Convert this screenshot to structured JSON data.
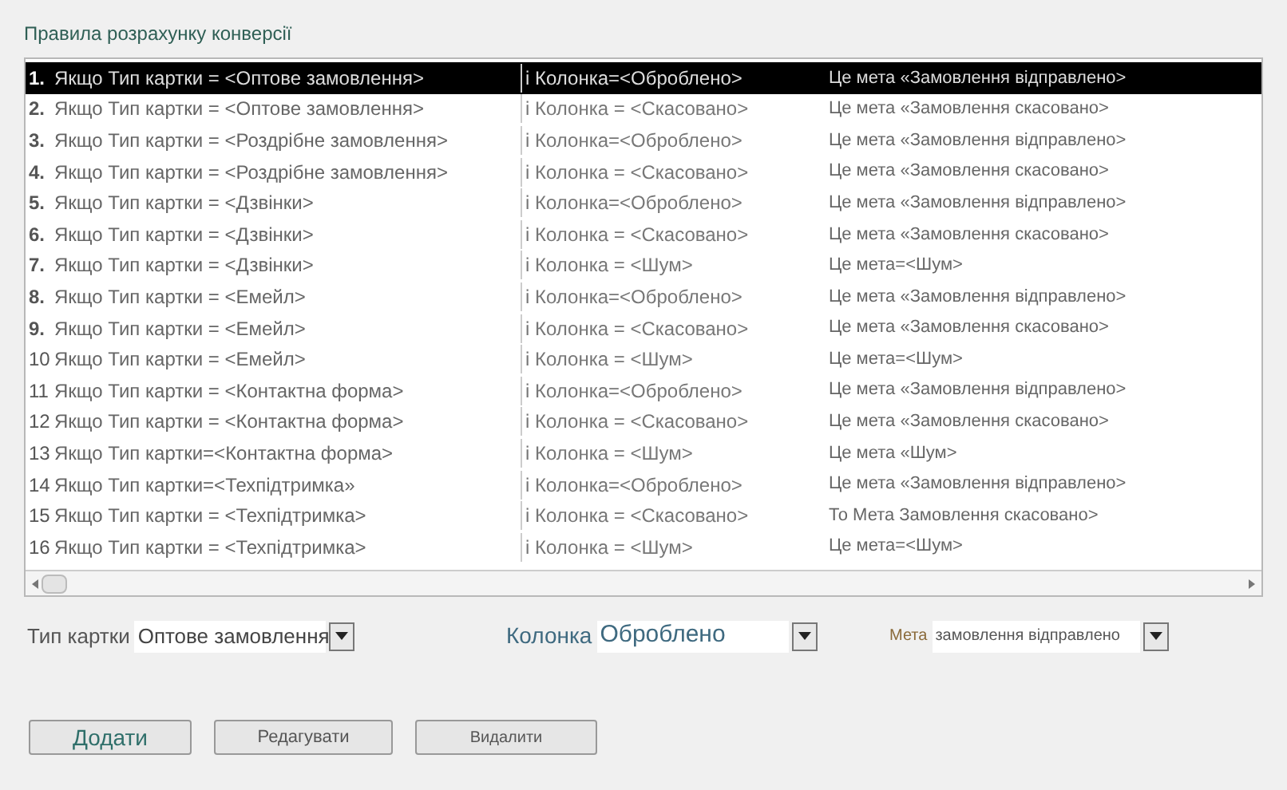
{
  "title": "Правила розрахунку конверсії",
  "rules": [
    {
      "number": "1.",
      "condition": "Якщо Тип картки = <Оптове замовлення>",
      "column": "і Колонка=<Оброблено>",
      "goal": "Це мета «Замовлення відправлено>",
      "selected": true
    },
    {
      "number": "2.",
      "condition": "Якщо Тип картки = <Оптове замовлення>",
      "column": "і Колонка = <Скасовано>",
      "goal": "Це мета «Замовлення скасовано>",
      "selected": false
    },
    {
      "number": "3.",
      "condition": "Якщо Тип картки = <Роздрібне замовлення>",
      "column": "і Колонка=<Оброблено>",
      "goal": "Це мета «Замовлення відправлено>",
      "selected": false
    },
    {
      "number": "4.",
      "condition": "Якщо Тип картки = <Роздрібне замовлення>",
      "column": "і Колонка = <Скасовано>",
      "goal": "Це мета «Замовлення скасовано>",
      "selected": false
    },
    {
      "number": "5.",
      "condition": "Якщо Тип картки = <Дзвінки>",
      "column": "і Колонка=<Оброблено>",
      "goal": "Це мета «Замовлення відправлено>",
      "selected": false
    },
    {
      "number": "6.",
      "condition": "Якщо Тип картки = <Дзвінки>",
      "column": "і Колонка = <Скасовано>",
      "goal": "Це мета «Замовлення скасовано>",
      "selected": false
    },
    {
      "number": "7.",
      "condition": "Якщо Тип картки = <Дзвінки>",
      "column": "і Колонка = <Шум>",
      "goal": "Це мета=<Шум>",
      "selected": false
    },
    {
      "number": "8.",
      "condition": "Якщо Тип картки = <Емейл>",
      "column": "і Колонка=<Оброблено>",
      "goal": "Це мета «Замовлення відправлено>",
      "selected": false
    },
    {
      "number": "9.",
      "condition": "Якщо Тип картки = <Емейл>",
      "column": "і Колонка = <Скасовано>",
      "goal": "Це мета «Замовлення скасовано>",
      "selected": false
    },
    {
      "number": "10",
      "condition": "Якщо Тип картки = <Емейл>",
      "column": "і Колонка = <Шум>",
      "goal": "Це мета=<Шум>",
      "selected": false
    },
    {
      "number": "11",
      "condition": "Якщо Тип картки = <Контактна форма>",
      "column": "і Колонка=<Оброблено>",
      "goal": "Це мета «Замовлення відправлено>",
      "selected": false
    },
    {
      "number": "12",
      "condition": "Якщо Тип картки = <Контактна форма>",
      "column": "і Колонка = <Скасовано>",
      "goal": "Це мета «Замовлення скасовано>",
      "selected": false
    },
    {
      "number": "13",
      "condition": "Якщо Тип картки=<Контактна форма>",
      "column": "і Колонка = <Шум>",
      "goal": "Це мета «Шум>",
      "selected": false
    },
    {
      "number": "14",
      "condition": "Якщо Тип картки=<Техпідтримка»",
      "column": "і Колонка=<Оброблено>",
      "goal": "Це мета «Замовлення відправлено>",
      "selected": false
    },
    {
      "number": "15",
      "condition": "Якщо Тип картки = <Техпідтримка>",
      "column": "і Колонка = <Скасовано>",
      "goal": "То Мета Замовлення скасовано>",
      "selected": false
    },
    {
      "number": "16",
      "condition": "Якщо Тип картки = <Техпідтримка>",
      "column": "і Колонка = <Шум>",
      "goal": "Це мета=<Шум>",
      "selected": false
    }
  ],
  "filters": [
    {
      "label": "Тип картки",
      "value": "Оптове замовлення"
    },
    {
      "label": "Колонка",
      "value": "Оброблено"
    },
    {
      "label": "Мета",
      "value": "замовлення відправлено"
    }
  ],
  "buttons": [
    "Додати",
    "Редагувати",
    "Видалити"
  ]
}
